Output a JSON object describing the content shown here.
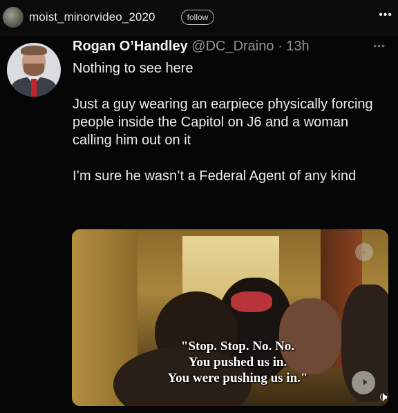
{
  "header": {
    "username": "moist_minorvideo_2020",
    "follow_label": "follow",
    "more_label": "•••"
  },
  "tweet": {
    "author_name": "Rogan O’Handley",
    "author_handle": "@DC_Draino",
    "time": "· 13h",
    "more_label": "•••",
    "paragraphs": [
      "Nothing to see here",
      "Just a guy wearing an earpiece physically forcing people inside the Capitol on J6 and a woman calling him out on it",
      "I’m sure he wasn’t a Federal Agent of any kind"
    ],
    "video_caption": [
      "\"Stop. Stop. No. No.",
      "You pushed us in.",
      "You were pushing us in.\""
    ]
  },
  "icons": {
    "sound": "speaker-icon",
    "more": "more-dots-icon"
  }
}
